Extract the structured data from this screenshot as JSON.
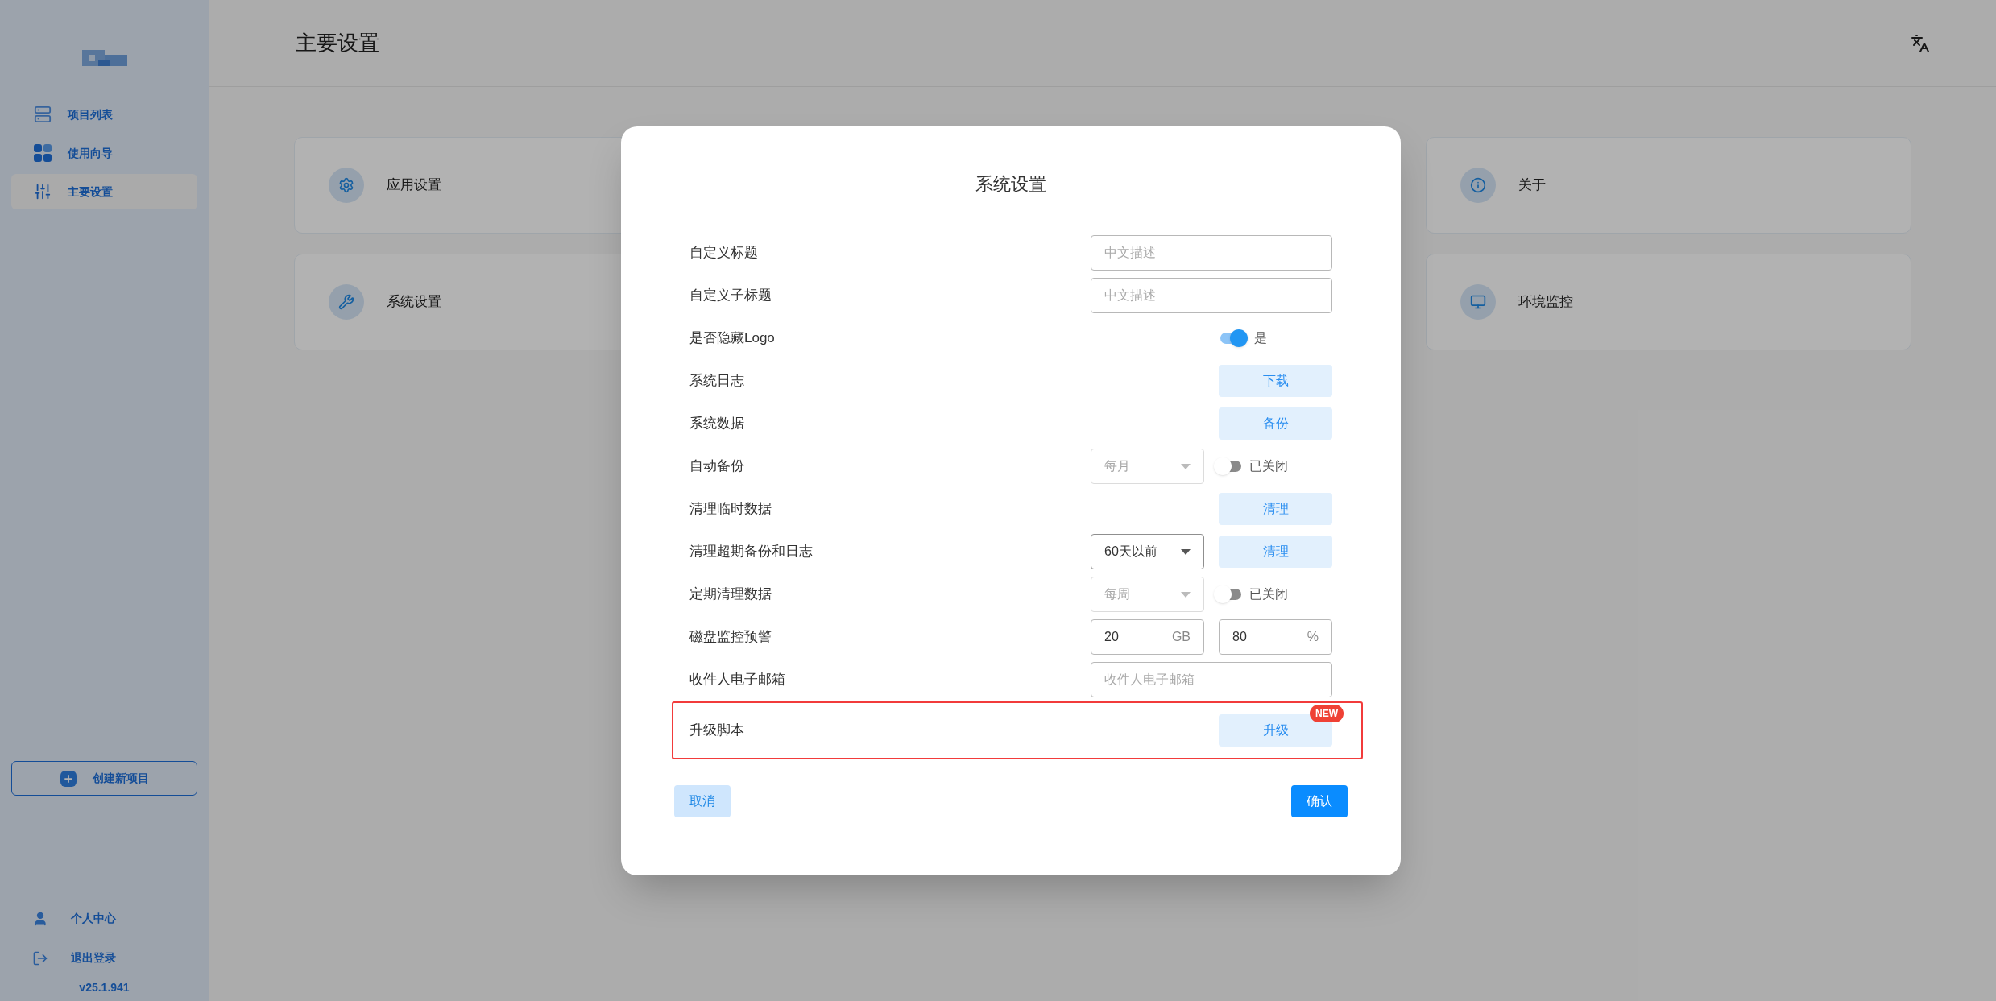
{
  "sidebar": {
    "items": [
      {
        "label": "项目列表",
        "selected": false
      },
      {
        "label": "使用向导",
        "selected": false
      },
      {
        "label": "主要设置",
        "selected": true
      }
    ],
    "create_button": "创建新项目",
    "footer_items": [
      {
        "label": "个人中心"
      },
      {
        "label": "退出登录"
      }
    ],
    "version": "v25.1.941"
  },
  "header": {
    "title": "主要设置"
  },
  "cards": [
    {
      "label": "应用设置"
    },
    {
      "label": "关于"
    },
    {
      "label": "系统设置"
    },
    {
      "label": "环境监控"
    }
  ],
  "modal": {
    "title": "系统设置",
    "rows": [
      {
        "kind": "input",
        "label": "自定义标题",
        "placeholder": "中文描述",
        "highlighted": false
      },
      {
        "kind": "input",
        "label": "自定义子标题",
        "placeholder": "中文描述",
        "highlighted": false
      },
      {
        "kind": "switch",
        "label": "是否隐藏Logo",
        "on": true,
        "state_text": "是",
        "highlighted": false
      },
      {
        "kind": "button",
        "label": "系统日志",
        "button": "下载",
        "highlighted": false
      },
      {
        "kind": "button",
        "label": "系统数据",
        "button": "备份",
        "highlighted": false
      },
      {
        "kind": "select_switch",
        "label": "自动备份",
        "select": {
          "value": "每月",
          "disabled": true
        },
        "on": false,
        "state_text": "已关闭",
        "highlighted": false
      },
      {
        "kind": "button",
        "label": "清理临时数据",
        "button": "清理",
        "highlighted": false
      },
      {
        "kind": "select_button",
        "label": "清理超期备份和日志",
        "select": {
          "value": "60天以前",
          "disabled": false
        },
        "button": "清理",
        "highlighted": false
      },
      {
        "kind": "select_switch",
        "label": "定期清理数据",
        "select": {
          "value": "每周",
          "disabled": true
        },
        "on": false,
        "state_text": "已关闭",
        "highlighted": false
      },
      {
        "kind": "unit_inputs",
        "label": "磁盘监控预警",
        "inputs": [
          {
            "value": "20",
            "unit": "GB"
          },
          {
            "value": "80",
            "unit": "%"
          }
        ],
        "highlighted": false
      },
      {
        "kind": "input",
        "label": "收件人电子邮箱",
        "placeholder": "收件人电子邮箱",
        "highlighted": false
      },
      {
        "kind": "button",
        "label": "升级脚本",
        "button": "升级",
        "badge": "NEW",
        "highlighted": true
      }
    ],
    "cancel": "取消",
    "confirm": "确认"
  }
}
